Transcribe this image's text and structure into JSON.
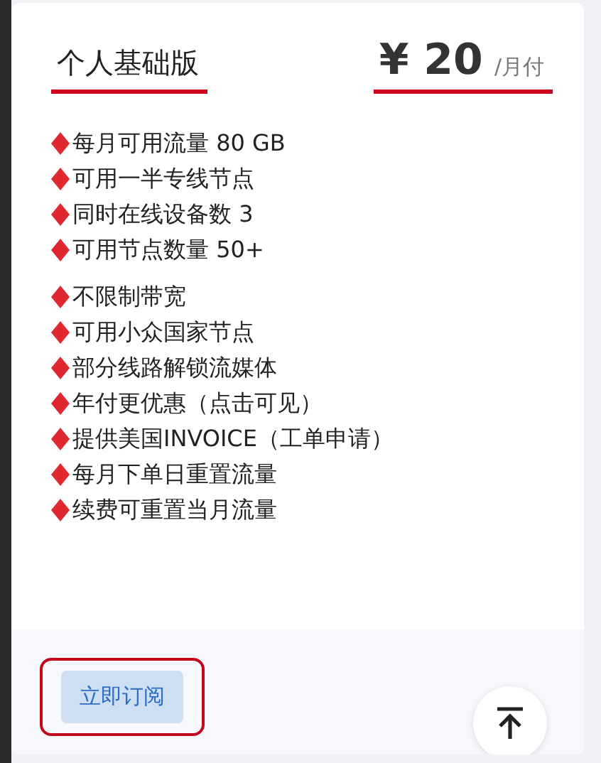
{
  "plan": {
    "name": "个人基础版",
    "price": "¥ 20",
    "period": "/月付"
  },
  "feature_groups": [
    {
      "items": [
        "每月可用流量 80 GB",
        "可用一半专线节点",
        "同时在线设备数 3",
        "可用节点数量 50+"
      ]
    },
    {
      "items": [
        "不限制带宽",
        "可用小众国家节点",
        "部分线路解锁流媒体",
        "年付更优惠（点击可见）",
        "提供美国INVOICE（工单申请）",
        "每月下单日重置流量",
        "续费可重置当月流量"
      ]
    }
  ],
  "subscribe_button": {
    "label": "立即订阅"
  }
}
